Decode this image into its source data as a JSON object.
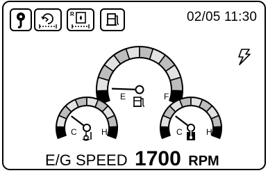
{
  "topbar": {
    "buttons": [
      {
        "icon": "hook-icon"
      },
      {
        "icon": "swing-lock-icon"
      },
      {
        "icon": "radiator-coolant-icon"
      },
      {
        "icon": "fuel-pump-icon"
      }
    ],
    "datetime": "02/05 11:30"
  },
  "status": {
    "icon": "lightning-icon"
  },
  "gauges": [
    {
      "id": "fuel",
      "icon": "fuel-pump-icon",
      "min_label": "E",
      "max_label": "F",
      "level": 0.1
    },
    {
      "id": "oil-temp",
      "icon": "oil-temperature-icon",
      "min_label": "C",
      "max_label": "H",
      "level": 0.26
    },
    {
      "id": "coolant-temp",
      "icon": "coolant-temperature-icon",
      "min_label": "C",
      "max_label": "H",
      "level": 0.26
    }
  ],
  "engine": {
    "label": "E/G SPEED",
    "value": "1700",
    "unit": "RPM"
  }
}
